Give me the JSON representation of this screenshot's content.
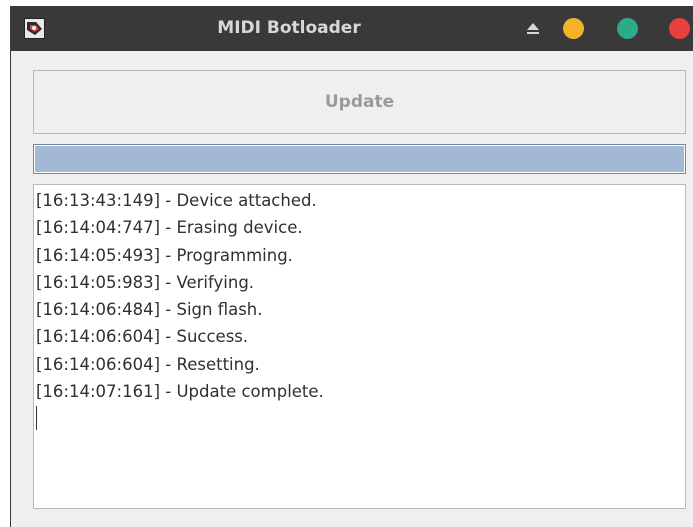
{
  "window": {
    "title": "MIDI Botloader",
    "icons": {
      "app": "app-logo-icon",
      "eject": "eject-icon",
      "minimize": "minimize-icon",
      "maximize": "maximize-icon",
      "close": "close-icon"
    },
    "colors": {
      "titlebar": "#393939",
      "minimize": "#f2b329",
      "maximize": "#2bab8a",
      "close": "#ea3f3f"
    }
  },
  "update_button": {
    "label": "Update"
  },
  "progress": {
    "value": 1.0,
    "color": "#a3b9d3"
  },
  "log": {
    "lines": [
      "[16:13:43:149] - Device attached.",
      "[16:14:04:747] - Erasing device.",
      "[16:14:05:493] - Programming.",
      "[16:14:05:983] - Verifying.",
      "[16:14:06:484] - Sign flash.",
      "[16:14:06:604] - Success.",
      "[16:14:06:604] - Resetting.",
      "[16:14:07:161] - Update complete."
    ]
  }
}
